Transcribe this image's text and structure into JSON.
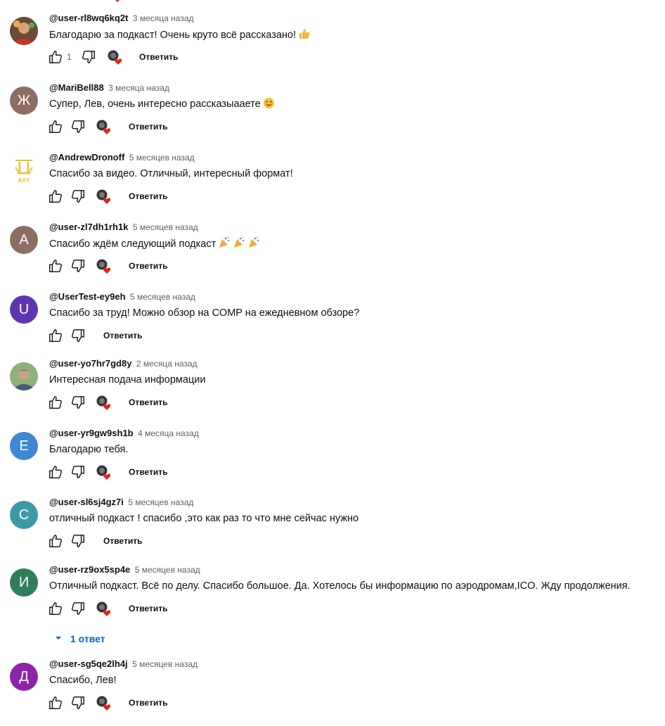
{
  "reply_label": "Ответить",
  "colors": {
    "link": "#065fd4",
    "heart": "#e62117"
  },
  "replies_toggle": {
    "label": "1 ответ"
  },
  "comments": [
    {
      "author": "@user-rl8wq6kq2t",
      "time": "3 месяца назад",
      "text": "Благодарю за подкаст! Очень круто всё рассказано!",
      "emoji": "thumbs-up",
      "likes": "1",
      "heart": true,
      "avatar": {
        "type": "photo",
        "color": "#8a5a3c"
      }
    },
    {
      "author": "@MariBell88",
      "time": "3 месяца назад",
      "text": "Супер, Лев, очень интересно рассказыааете",
      "emoji": "smile",
      "likes": "",
      "heart": true,
      "avatar": {
        "type": "letter",
        "letter": "Ж",
        "color": "#8d6e63"
      }
    },
    {
      "author": "@AndrewDronoff",
      "time": "5 месяцев назад",
      "text": "Спасибо за видео. Отличный, интересный формат!",
      "emoji": "",
      "likes": "",
      "heart": true,
      "avatar": {
        "type": "logo",
        "letter": "AXY",
        "color": "#e6c229"
      }
    },
    {
      "author": "@user-zl7dh1rh1k",
      "time": "5 месяцев назад",
      "text": "Спасибо ждём следующий подкаст",
      "emoji": "party-x3",
      "likes": "",
      "heart": true,
      "avatar": {
        "type": "letter",
        "letter": "А",
        "color": "#8d6e63"
      }
    },
    {
      "author": "@UserTest-ey9eh",
      "time": "5 месяцев назад",
      "text": "Спасибо за труд! Можно обзор на COMP на ежедневном обзоре?",
      "emoji": "",
      "likes": "",
      "heart": false,
      "avatar": {
        "type": "letter",
        "letter": "U",
        "color": "#5e35b1"
      }
    },
    {
      "author": "@user-yo7hr7gd8y",
      "time": "2 месяца назад",
      "text": "Интересная подача информации",
      "emoji": "",
      "likes": "",
      "heart": true,
      "avatar": {
        "type": "photo",
        "color": "#7a9a6a"
      }
    },
    {
      "author": "@user-yr9gw9sh1b",
      "time": "4 месяца назад",
      "text": "Благодарю тебя.",
      "emoji": "",
      "likes": "",
      "heart": true,
      "avatar": {
        "type": "letter",
        "letter": "E",
        "color": "#3f88d3"
      }
    },
    {
      "author": "@user-sl6sj4gz7i",
      "time": "5 месяцев назад",
      "text": "отличный подкаст ! спасибо ,это как раз то что мне сейчас нужно",
      "emoji": "",
      "likes": "",
      "heart": false,
      "avatar": {
        "type": "letter",
        "letter": "С",
        "color": "#3e99a7"
      }
    },
    {
      "author": "@user-rz9ox5sp4e",
      "time": "5 месяцев назад",
      "text": "Отличный подкаст. Всё по делу. Спасибо большое. Да. Хотелось бы информацию по аэродромам,ICO. Жду продолжения.",
      "emoji": "",
      "likes": "",
      "heart": true,
      "avatar": {
        "type": "letter",
        "letter": "И",
        "color": "#2e7d5b"
      }
    },
    {
      "author": "@user-sg5qe2lh4j",
      "time": "5 месяцев назад",
      "text": "Спасибо, Лев!",
      "emoji": "",
      "likes": "",
      "heart": true,
      "avatar": {
        "type": "letter",
        "letter": "Д",
        "color": "#8e24aa"
      }
    }
  ]
}
